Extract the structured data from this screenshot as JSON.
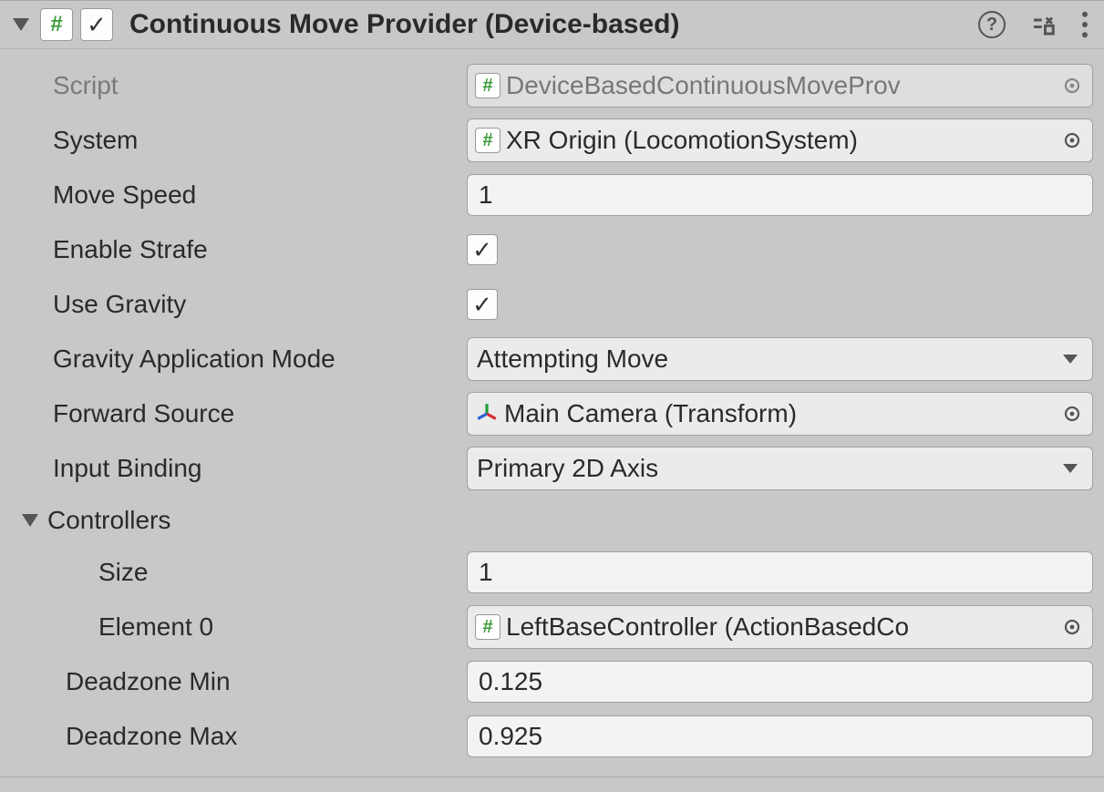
{
  "header": {
    "title": "Continuous Move Provider (Device-based)",
    "enabled": true
  },
  "fields": {
    "script": {
      "label": "Script",
      "value": "DeviceBasedContinuousMoveProv"
    },
    "system": {
      "label": "System",
      "value": "XR Origin (LocomotionSystem)"
    },
    "moveSpeed": {
      "label": "Move Speed",
      "value": "1"
    },
    "enableStrafe": {
      "label": "Enable Strafe",
      "value": true
    },
    "useGravity": {
      "label": "Use Gravity",
      "value": true
    },
    "gravityMode": {
      "label": "Gravity Application Mode",
      "value": "Attempting Move"
    },
    "forwardSource": {
      "label": "Forward Source",
      "value": "Main Camera (Transform)"
    },
    "inputBinding": {
      "label": "Input Binding",
      "value": "Primary 2D Axis"
    },
    "controllers": {
      "label": "Controllers",
      "sizeLabel": "Size",
      "size": "1",
      "element0Label": "Element 0",
      "element0": "LeftBaseController (ActionBasedCo"
    },
    "deadzoneMin": {
      "label": "Deadzone Min",
      "value": "0.125"
    },
    "deadzoneMax": {
      "label": "Deadzone Max",
      "value": "0.925"
    }
  }
}
